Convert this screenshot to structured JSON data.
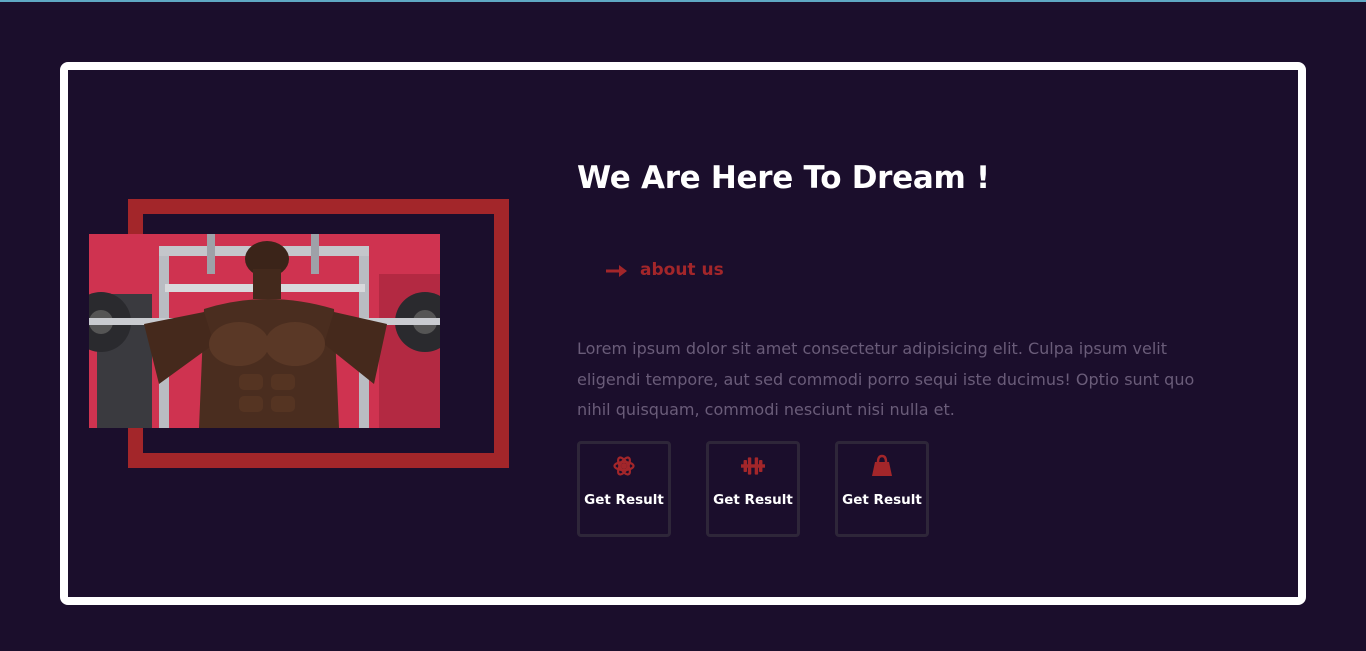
{
  "colors": {
    "background": "#1b0e2c",
    "frame": "#ffffff",
    "accent_red": "#a3262a",
    "muted_text": "#6a5c79",
    "card_border": "#2e2639"
  },
  "hero": {
    "title": "We Are Here To Dream !",
    "about_link": {
      "icon": "arrow-right-icon",
      "label": "about us"
    },
    "description": "Lorem ipsum dolor sit amet consectetur adipisicing elit. Culpa ipsum velit eligendi tempore, aut sed commodi porro sequi iste ducimus! Optio sunt quo nihil quisquam, commodi nesciunt nisi nulla et.",
    "image": {
      "subject": "bodybuilder-bench-press-photo"
    }
  },
  "features": [
    {
      "icon": "atom-gear-icon",
      "label": "Get Result"
    },
    {
      "icon": "dumbbell-icon",
      "label": "Get Result"
    },
    {
      "icon": "kettlebell-bag-icon",
      "label": "Get Result"
    }
  ]
}
